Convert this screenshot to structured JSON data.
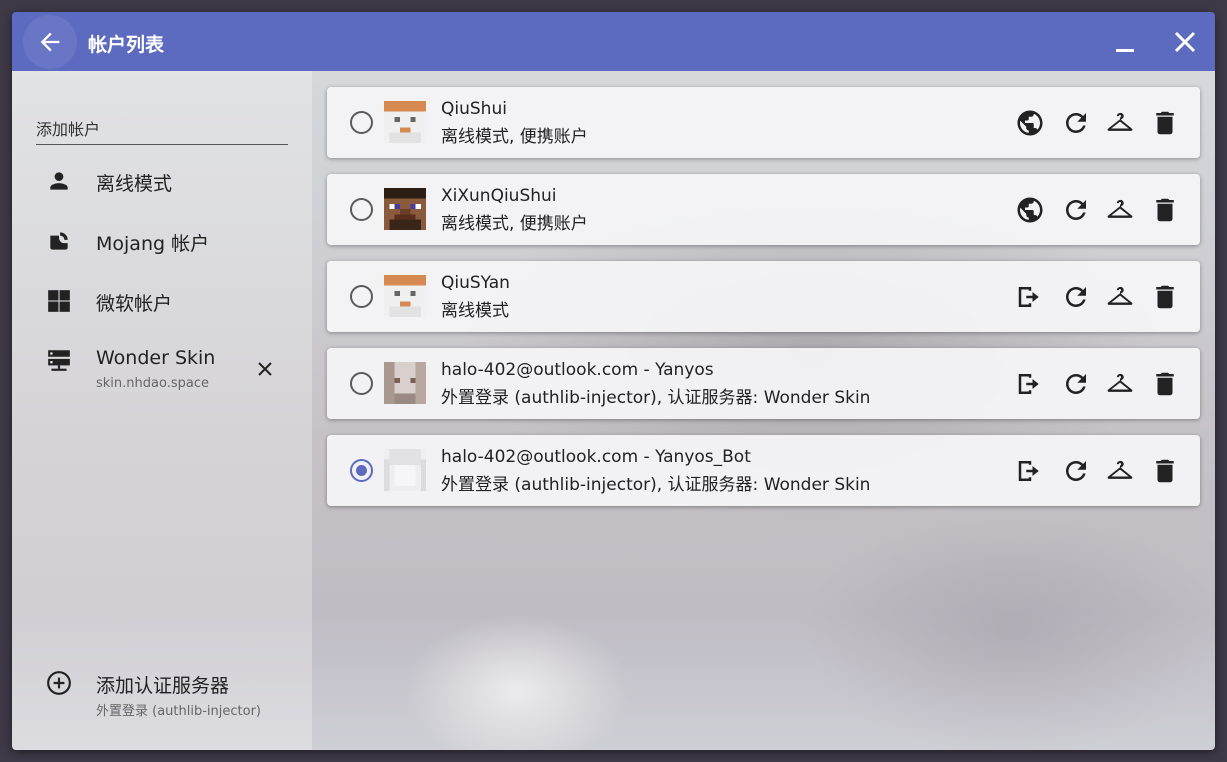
{
  "window": {
    "title": "帐户列表",
    "accent": "#5c6bc0"
  },
  "sidebar": {
    "add_header": "添加帐户",
    "items": [
      {
        "label": "离线模式",
        "icon": "person-icon"
      },
      {
        "label": "Mojang 帐户",
        "icon": "mojang-icon"
      },
      {
        "label": "微软帐户",
        "icon": "microsoft-icon"
      },
      {
        "label": "Wonder Skin",
        "sub": "skin.nhdao.space",
        "icon": "server-icon"
      }
    ],
    "add_server": {
      "label": "添加认证服务器",
      "sub": "外置登录 (authlib-injector)"
    }
  },
  "accounts": [
    {
      "name": "QiuShui",
      "sub": "离线模式, 便携账户",
      "selected": false,
      "first_action": "globe-icon"
    },
    {
      "name": "XiXunQiuShui",
      "sub": "离线模式, 便携账户",
      "selected": false,
      "first_action": "globe-icon"
    },
    {
      "name": "QiuSYan",
      "sub": "离线模式",
      "selected": false,
      "first_action": "logout-icon"
    },
    {
      "name": "halo-402@outlook.com - Yanyos",
      "sub": "外置登录 (authlib-injector), 认证服务器: Wonder Skin",
      "selected": false,
      "first_action": "logout-icon"
    },
    {
      "name": "halo-402@outlook.com - Yanyos_Bot",
      "sub": "外置登录 (authlib-injector), 认证服务器: Wonder Skin",
      "selected": true,
      "first_action": "logout-icon"
    }
  ]
}
